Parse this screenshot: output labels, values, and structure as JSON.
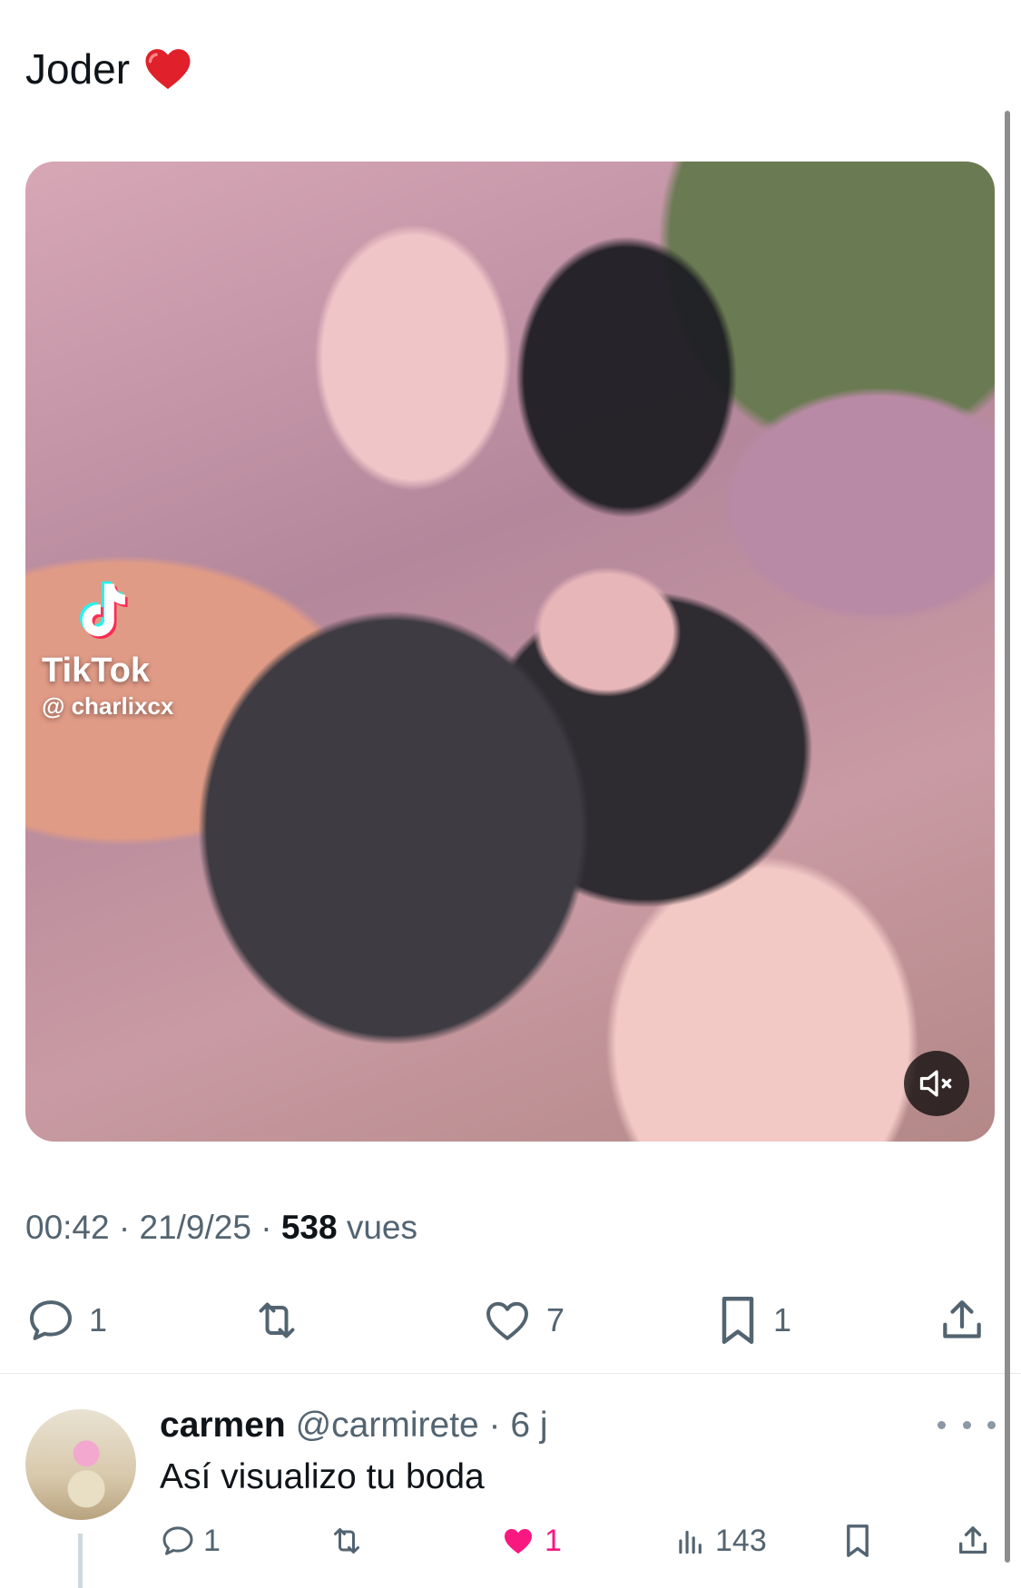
{
  "post": {
    "text": "Joder",
    "emoji": "red-heart",
    "media": {
      "watermark_brand": "TikTok",
      "watermark_handle": "@ charlixcx",
      "mute_icon": "speaker-muted-icon"
    },
    "meta": {
      "time": "00:42",
      "sep1": " · ",
      "date": "21/9/25",
      "sep2": " · ",
      "views_count": "538",
      "views_label": " vues"
    },
    "actions": {
      "replies": "1",
      "retweets": "",
      "likes": "7",
      "bookmarks": "1"
    }
  },
  "reply": {
    "name": "carmen",
    "handle": "@carmirete",
    "time": " · 6 j",
    "text": "Así visualizo tu boda",
    "actions": {
      "replies": "1",
      "retweets": "",
      "likes": "1",
      "views": "143"
    }
  },
  "colors": {
    "text": "#0f1419",
    "secondary": "#536471",
    "like_active": "#f91880",
    "heart_emoji": "#e0202a"
  }
}
